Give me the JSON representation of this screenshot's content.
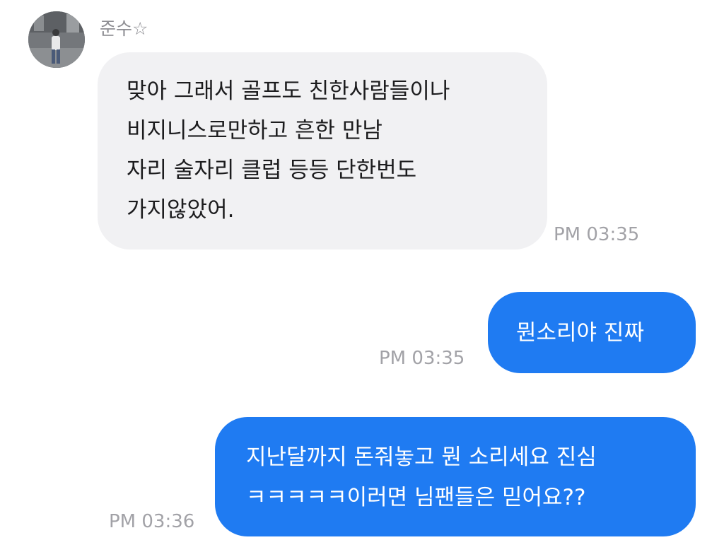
{
  "contact": {
    "name": "준수☆",
    "avatar_icon": "profile-photo-icon"
  },
  "messages": [
    {
      "direction": "incoming",
      "lines": [
        "맞아 그래서 골프도 친한사람들이나",
        "비지니스로만하고 흔한 만남",
        "자리 술자리 클럽 등등 단한번도",
        "가지않았어."
      ],
      "time": "PM 03:35"
    },
    {
      "direction": "outgoing",
      "lines": [
        "뭔소리야 진짜"
      ],
      "time": "PM 03:35"
    },
    {
      "direction": "outgoing",
      "lines": [
        "지난달까지 돈줘놓고 뭔 소리세요 진심",
        "ㅋㅋㅋㅋㅋ이러면 님팬들은 믿어요??"
      ],
      "time": "PM 03:36"
    }
  ],
  "colors": {
    "incoming_bubble": "#f1f1f3",
    "outgoing_bubble": "#1f7bf2",
    "timestamp": "#a2a2a7",
    "sender_name": "#8e8e93"
  }
}
